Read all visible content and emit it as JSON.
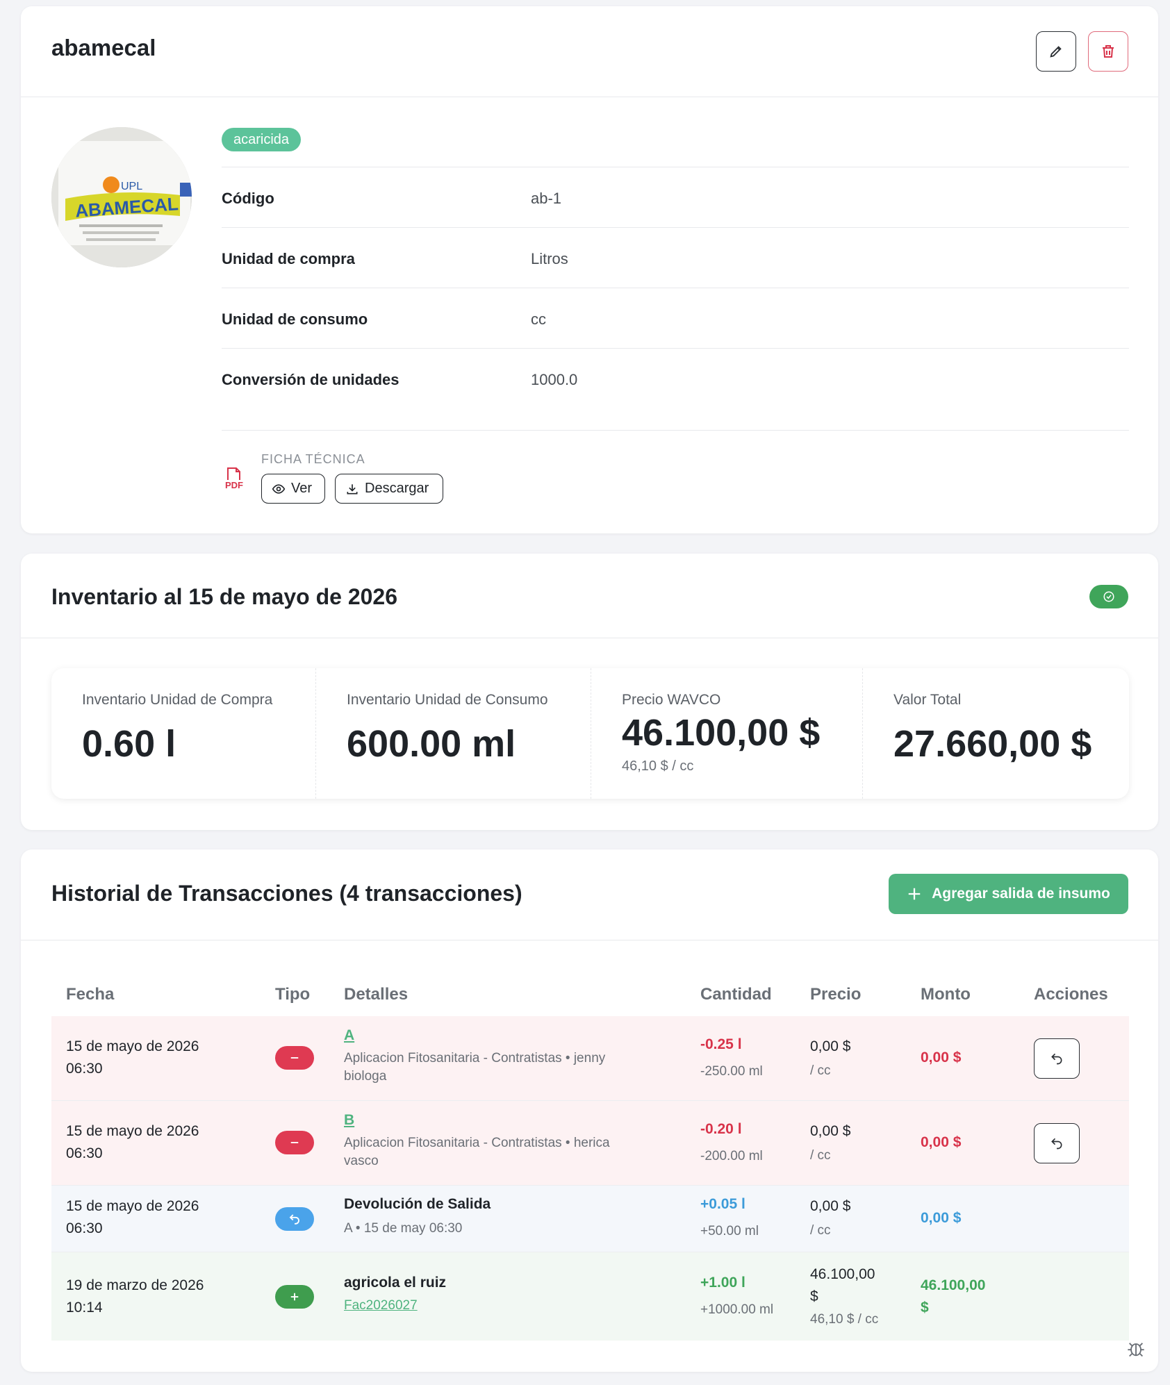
{
  "product": {
    "name": "abamecal",
    "tag": "acaricida",
    "image_label": "ABAMECAL",
    "image_brand": "UPL",
    "fields": [
      {
        "label": "Código",
        "value": "ab-1"
      },
      {
        "label": "Unidad de compra",
        "value": "Litros"
      },
      {
        "label": "Unidad de consumo",
        "value": "cc"
      },
      {
        "label": "Conversión de unidades",
        "value": "1000.0"
      }
    ],
    "ficha_label": "FICHA TÉCNICA",
    "pdf_label": "PDF",
    "ver_label": "Ver",
    "descargar_label": "Descargar",
    "icons": {
      "edit": "pencil-icon",
      "delete": "trash-icon",
      "pdf": "pdf-file-icon",
      "ver": "eye-icon",
      "descargar": "download-icon"
    }
  },
  "inventory": {
    "title": "Inventario al 15 de mayo de 2026",
    "status_icon": "check-circle-icon",
    "stats": [
      {
        "label": "Inventario Unidad de Compra",
        "value": "0.60 l",
        "sub": ""
      },
      {
        "label": "Inventario Unidad de Consumo",
        "value": "600.00 ml",
        "sub": ""
      },
      {
        "label": "Precio WAVCO",
        "value": "46.100,00 $",
        "sub": "46,10 $ / cc"
      },
      {
        "label": "Valor Total",
        "value": "27.660,00 $",
        "sub": ""
      }
    ]
  },
  "transactions": {
    "title": "Historial de Transacciones (4 transacciones)",
    "add_button": "Agregar salida de insumo",
    "columns": [
      "Fecha",
      "Tipo",
      "Detalles",
      "Cantidad",
      "Precio",
      "Monto",
      "Acciones"
    ],
    "rows": [
      {
        "date": "15 de mayo de 2026",
        "time": "06:30",
        "type": "salida",
        "title": "A",
        "detail_line1": "Aplicacion Fitosanitaria - Contratistas • jenny",
        "detail_line2": "biologa",
        "qty": "-0.25 l",
        "qty_sub": "-250.00 ml",
        "price": "0,00 $",
        "price_sub": "/ cc",
        "monto": "0,00 $",
        "action": "undo-icon"
      },
      {
        "date": "15 de mayo de 2026",
        "time": "06:30",
        "type": "salida",
        "title": "B",
        "detail_line1": "Aplicacion Fitosanitaria - Contratistas • herica",
        "detail_line2": "vasco",
        "qty": "-0.20 l",
        "qty_sub": "-200.00 ml",
        "price": "0,00 $",
        "price_sub": "/ cc",
        "monto": "0,00 $",
        "action": "undo-icon"
      },
      {
        "date": "15 de mayo de 2026",
        "time": "06:30",
        "type": "devolucion",
        "title": "Devolución de Salida",
        "detail_line1": "A • 15 de may 06:30",
        "qty": "+0.05 l",
        "qty_sub": "+50.00 ml",
        "price": "0,00 $",
        "price_sub": "/ cc",
        "monto": "0,00 $"
      },
      {
        "date": "19 de marzo de 2026",
        "time": "10:14",
        "type": "entrada",
        "title": "agricola el ruiz",
        "detail_link": "Fac2026027",
        "qty": "+1.00 l",
        "qty_sub": "+1000.00 ml",
        "price": "46.100,00",
        "price_line2": "$",
        "price_sub": "46,10 $ / cc",
        "monto": "46.100,00",
        "monto_line2": "$"
      }
    ]
  },
  "colors": {
    "salida_bg": "#fdf2f3",
    "devolucion_bg": "#f4f7fb",
    "entrada_bg": "#f2f8f3",
    "red": "#d8334a",
    "blue": "#3c9bd9",
    "green": "#3fa55a",
    "brand": "#4fb37f"
  }
}
